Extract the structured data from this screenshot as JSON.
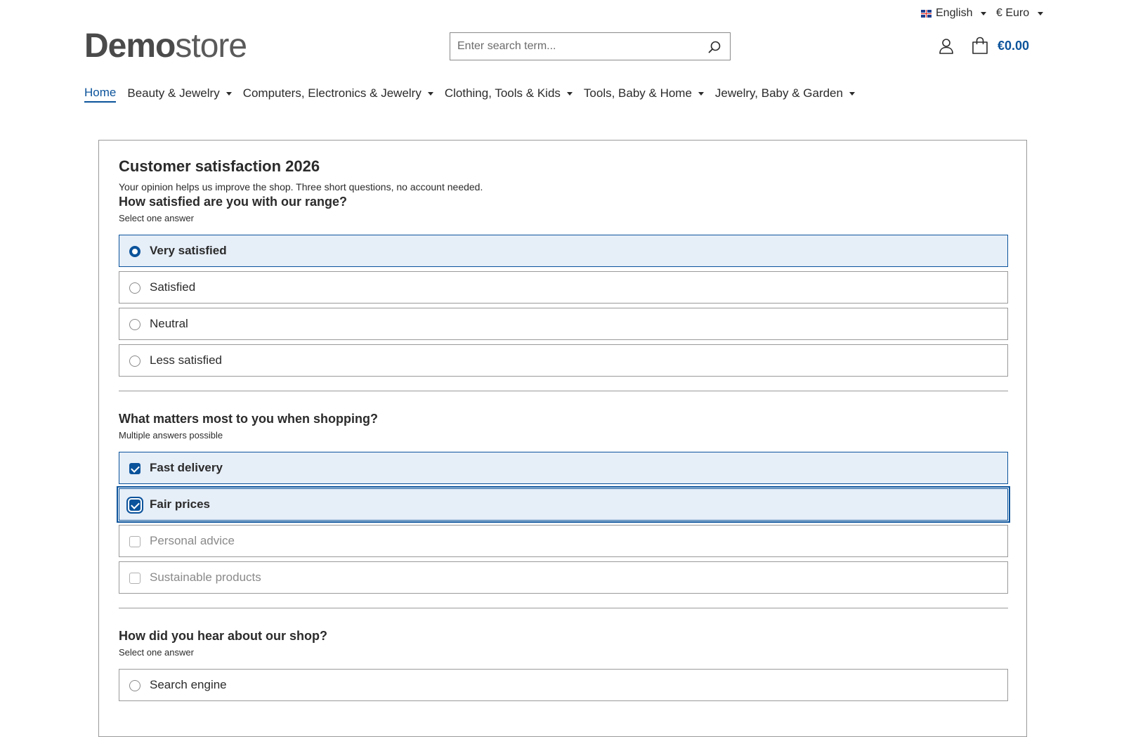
{
  "topbar": {
    "language": "English",
    "currency": "€ Euro"
  },
  "header": {
    "logo_bold": "Demo",
    "logo_light": "store",
    "search_placeholder": "Enter search term...",
    "cart_total": "€0.00"
  },
  "nav": {
    "items": [
      {
        "label": "Home",
        "active": true
      },
      {
        "label": "Beauty & Jewelry"
      },
      {
        "label": "Computers, Electronics & Jewelry"
      },
      {
        "label": "Clothing, Tools & Kids"
      },
      {
        "label": "Tools, Baby & Home"
      },
      {
        "label": "Jewelry, Baby & Garden"
      }
    ]
  },
  "survey": {
    "title": "Customer satisfaction 2026",
    "intro": "Your opinion helps us improve the shop. Three short questions, no account needed.",
    "questions": [
      {
        "title": "How satisfied are you with our range?",
        "hint": "Select one answer",
        "options": [
          "Very satisfied",
          "Satisfied",
          "Neutral",
          "Less satisfied"
        ],
        "selected": "Very satisfied"
      },
      {
        "title": "What matters most to you when shopping?",
        "hint": "Multiple answers possible",
        "options": [
          "Fast delivery",
          "Fair prices",
          "Personal advice",
          "Sustainable products"
        ],
        "checked": [
          "Fast delivery",
          "Fair prices"
        ]
      },
      {
        "title": "How did you hear about our shop?",
        "hint": "Select one answer",
        "options": [
          "Search engine"
        ]
      }
    ]
  },
  "colors": {
    "accent": "#0b539b",
    "selected_bg": "#e6eef8"
  }
}
